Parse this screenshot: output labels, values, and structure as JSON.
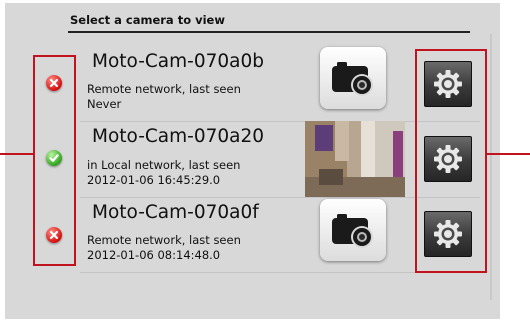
{
  "header": {
    "title": "Select a camera to view"
  },
  "cameras": [
    {
      "name": "Moto-Cam-070a0b",
      "network_text": "Remote network, last seen",
      "last_seen": "Never",
      "status": "offline",
      "thumbnail": "camera-placeholder-icon",
      "settings_icon": "gear-icon"
    },
    {
      "name": "Moto-Cam-070a20",
      "network_text": "in Local network, last seen",
      "last_seen": "2012-01-06 16:45:29.0",
      "status": "online",
      "thumbnail": "camera-snapshot-preview",
      "settings_icon": "gear-icon"
    },
    {
      "name": "Moto-Cam-070a0f",
      "network_text": "Remote network, last seen",
      "last_seen": "2012-01-06 08:14:48.0",
      "status": "offline",
      "thumbnail": "camera-placeholder-icon",
      "settings_icon": "gear-icon"
    }
  ],
  "colors": {
    "highlight": "#c1121f",
    "offline": "#d41010",
    "online": "#2fa41a",
    "panel_bg": "#d8d8d8"
  }
}
